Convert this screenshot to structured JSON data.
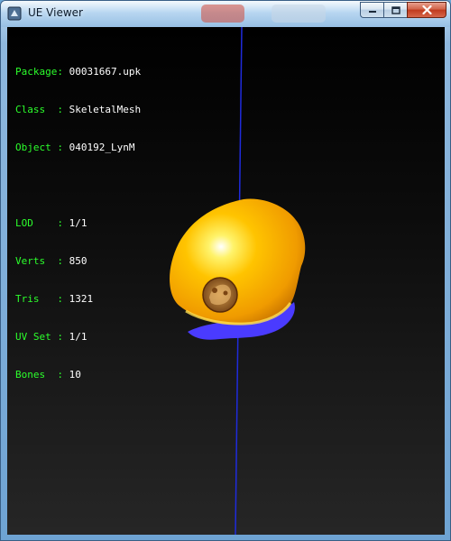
{
  "window": {
    "title": "UE Viewer",
    "buttons": {
      "minimize": "minimize",
      "maximize": "maximize",
      "close": "close"
    }
  },
  "info": {
    "package": {
      "label": "Package:",
      "value": "00031667.upk"
    },
    "class": {
      "label": "Class  :",
      "value": "SkeletalMesh"
    },
    "object": {
      "label": "Object :",
      "value": "040192_LynM"
    },
    "lod": {
      "label": "LOD    :",
      "value": "1/1"
    },
    "verts": {
      "label": "Verts  :",
      "value": "850"
    },
    "tris": {
      "label": "Tris   :",
      "value": "1321"
    },
    "uvset": {
      "label": "UV Set :",
      "value": "1/1"
    },
    "bones": {
      "label": "Bones  :",
      "value": "10"
    }
  },
  "colors": {
    "label_green": "#2cff2c",
    "value_white": "#ffffff",
    "axis_blue": "#1f2bdc",
    "mesh_gold": "#f0a800",
    "mesh_underside": "#4a3bff"
  },
  "viewport": {
    "model": "helmet-mesh",
    "emblem": "emblem-icon"
  }
}
